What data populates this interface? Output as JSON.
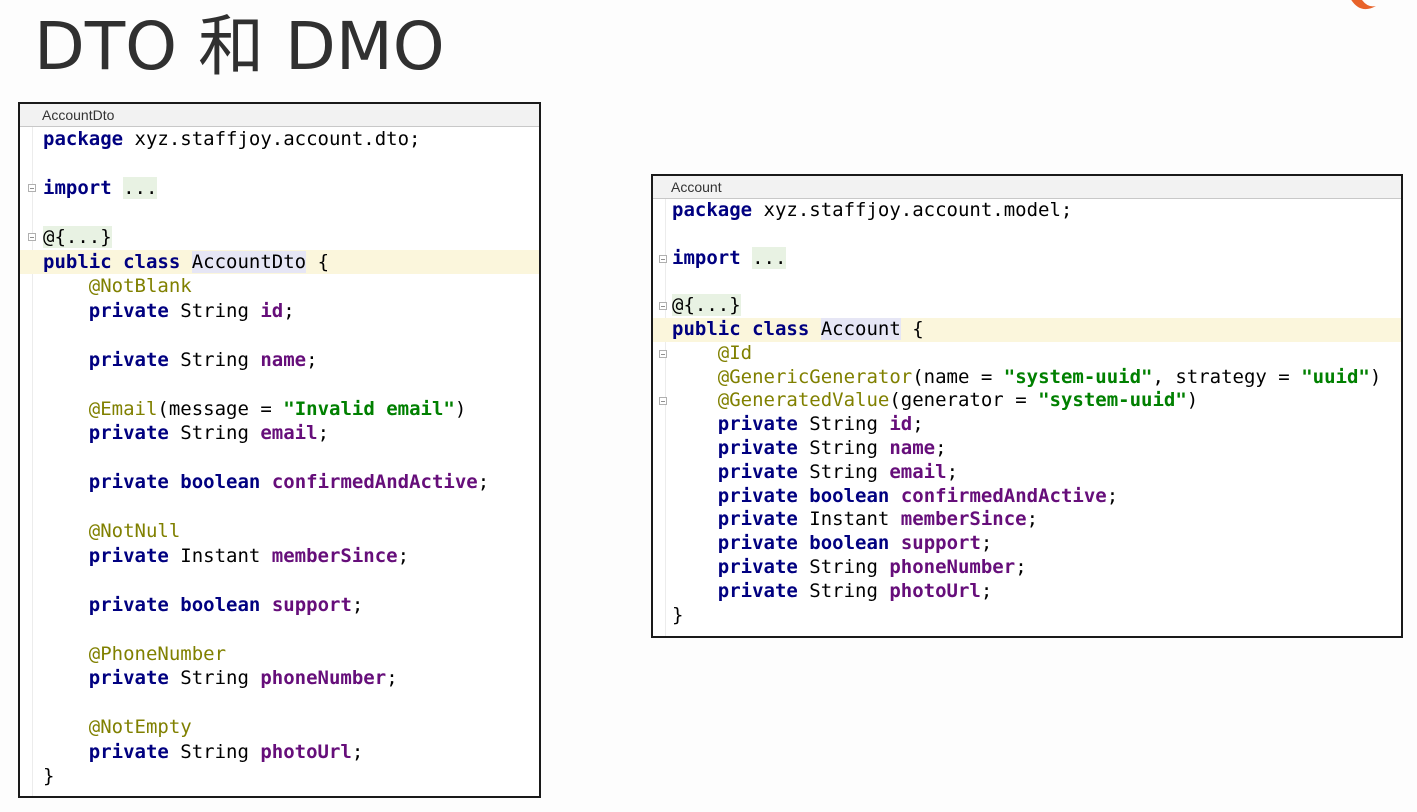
{
  "slide": {
    "title": "DTO 和 DMO"
  },
  "left_panel": {
    "tab_label": "AccountDto",
    "lines": [
      {
        "segments": [
          {
            "t": "package",
            "c": "kw"
          },
          {
            "t": " xyz.staffjoy.account.dto;",
            "c": ""
          }
        ]
      },
      {
        "segments": []
      },
      {
        "fold": true,
        "segments": [
          {
            "t": "import",
            "c": "kw"
          },
          {
            "t": " ",
            "c": ""
          },
          {
            "t": "...",
            "c": "fold"
          }
        ]
      },
      {
        "segments": []
      },
      {
        "fold": true,
        "segments": [
          {
            "t": "@{...}",
            "c": "fold"
          }
        ]
      },
      {
        "highlight": true,
        "segments": [
          {
            "t": "public class",
            "c": "kw"
          },
          {
            "t": " ",
            "c": ""
          },
          {
            "t": "AccountDto",
            "c": "sel"
          },
          {
            "t": " {",
            "c": ""
          }
        ]
      },
      {
        "segments": [
          {
            "t": "    ",
            "c": ""
          },
          {
            "t": "@NotBlank",
            "c": "ann"
          }
        ]
      },
      {
        "segments": [
          {
            "t": "    ",
            "c": ""
          },
          {
            "t": "private",
            "c": "kw"
          },
          {
            "t": " String ",
            "c": ""
          },
          {
            "t": "id",
            "c": "field"
          },
          {
            "t": ";",
            "c": ""
          }
        ]
      },
      {
        "segments": []
      },
      {
        "segments": [
          {
            "t": "    ",
            "c": ""
          },
          {
            "t": "private",
            "c": "kw"
          },
          {
            "t": " String ",
            "c": ""
          },
          {
            "t": "name",
            "c": "field"
          },
          {
            "t": ";",
            "c": ""
          }
        ]
      },
      {
        "segments": []
      },
      {
        "segments": [
          {
            "t": "    ",
            "c": ""
          },
          {
            "t": "@Email",
            "c": "ann"
          },
          {
            "t": "(message = ",
            "c": ""
          },
          {
            "t": "\"Invalid email\"",
            "c": "str"
          },
          {
            "t": ")",
            "c": ""
          }
        ]
      },
      {
        "segments": [
          {
            "t": "    ",
            "c": ""
          },
          {
            "t": "private",
            "c": "kw"
          },
          {
            "t": " String ",
            "c": ""
          },
          {
            "t": "email",
            "c": "field"
          },
          {
            "t": ";",
            "c": ""
          }
        ]
      },
      {
        "segments": []
      },
      {
        "segments": [
          {
            "t": "    ",
            "c": ""
          },
          {
            "t": "private boolean",
            "c": "kw"
          },
          {
            "t": " ",
            "c": ""
          },
          {
            "t": "confirmedAndActive",
            "c": "field"
          },
          {
            "t": ";",
            "c": ""
          }
        ]
      },
      {
        "segments": []
      },
      {
        "segments": [
          {
            "t": "    ",
            "c": ""
          },
          {
            "t": "@NotNull",
            "c": "ann"
          }
        ]
      },
      {
        "segments": [
          {
            "t": "    ",
            "c": ""
          },
          {
            "t": "private",
            "c": "kw"
          },
          {
            "t": " Instant ",
            "c": ""
          },
          {
            "t": "memberSince",
            "c": "field"
          },
          {
            "t": ";",
            "c": ""
          }
        ]
      },
      {
        "segments": []
      },
      {
        "segments": [
          {
            "t": "    ",
            "c": ""
          },
          {
            "t": "private boolean",
            "c": "kw"
          },
          {
            "t": " ",
            "c": ""
          },
          {
            "t": "support",
            "c": "field"
          },
          {
            "t": ";",
            "c": ""
          }
        ]
      },
      {
        "segments": []
      },
      {
        "segments": [
          {
            "t": "    ",
            "c": ""
          },
          {
            "t": "@PhoneNumber",
            "c": "ann"
          }
        ]
      },
      {
        "segments": [
          {
            "t": "    ",
            "c": ""
          },
          {
            "t": "private",
            "c": "kw"
          },
          {
            "t": " String ",
            "c": ""
          },
          {
            "t": "phoneNumber",
            "c": "field"
          },
          {
            "t": ";",
            "c": ""
          }
        ]
      },
      {
        "segments": []
      },
      {
        "segments": [
          {
            "t": "    ",
            "c": ""
          },
          {
            "t": "@NotEmpty",
            "c": "ann"
          }
        ]
      },
      {
        "segments": [
          {
            "t": "    ",
            "c": ""
          },
          {
            "t": "private",
            "c": "kw"
          },
          {
            "t": " String ",
            "c": ""
          },
          {
            "t": "photoUrl",
            "c": "field"
          },
          {
            "t": ";",
            "c": ""
          }
        ]
      },
      {
        "segments": [
          {
            "t": "}",
            "c": ""
          }
        ]
      }
    ]
  },
  "right_panel": {
    "tab_label": "Account",
    "lines": [
      {
        "segments": [
          {
            "t": "package",
            "c": "kw"
          },
          {
            "t": " xyz.staffjoy.account.model;",
            "c": ""
          }
        ]
      },
      {
        "segments": []
      },
      {
        "fold": true,
        "segments": [
          {
            "t": "import",
            "c": "kw"
          },
          {
            "t": " ",
            "c": ""
          },
          {
            "t": "...",
            "c": "fold"
          }
        ]
      },
      {
        "segments": []
      },
      {
        "fold": true,
        "segments": [
          {
            "t": "@{...}",
            "c": "fold"
          }
        ]
      },
      {
        "highlight": true,
        "segments": [
          {
            "t": "public class",
            "c": "kw"
          },
          {
            "t": " ",
            "c": ""
          },
          {
            "t": "Account",
            "c": "sel"
          },
          {
            "t": " {",
            "c": ""
          }
        ]
      },
      {
        "fold": true,
        "segments": [
          {
            "t": "    ",
            "c": ""
          },
          {
            "t": "@Id",
            "c": "ann"
          }
        ]
      },
      {
        "segments": [
          {
            "t": "    ",
            "c": ""
          },
          {
            "t": "@GenericGenerator",
            "c": "ann"
          },
          {
            "t": "(name = ",
            "c": ""
          },
          {
            "t": "\"system-uuid\"",
            "c": "str"
          },
          {
            "t": ", strategy = ",
            "c": ""
          },
          {
            "t": "\"uuid\"",
            "c": "str"
          },
          {
            "t": ")",
            "c": ""
          }
        ]
      },
      {
        "fold": true,
        "segments": [
          {
            "t": "    ",
            "c": ""
          },
          {
            "t": "@GeneratedValue",
            "c": "ann"
          },
          {
            "t": "(generator = ",
            "c": ""
          },
          {
            "t": "\"system-uuid\"",
            "c": "str"
          },
          {
            "t": ")",
            "c": ""
          }
        ]
      },
      {
        "segments": [
          {
            "t": "    ",
            "c": ""
          },
          {
            "t": "private",
            "c": "kw"
          },
          {
            "t": " String ",
            "c": ""
          },
          {
            "t": "id",
            "c": "field"
          },
          {
            "t": ";",
            "c": ""
          }
        ]
      },
      {
        "segments": [
          {
            "t": "    ",
            "c": ""
          },
          {
            "t": "private",
            "c": "kw"
          },
          {
            "t": " String ",
            "c": ""
          },
          {
            "t": "name",
            "c": "field"
          },
          {
            "t": ";",
            "c": ""
          }
        ]
      },
      {
        "segments": [
          {
            "t": "    ",
            "c": ""
          },
          {
            "t": "private",
            "c": "kw"
          },
          {
            "t": " String ",
            "c": ""
          },
          {
            "t": "email",
            "c": "field"
          },
          {
            "t": ";",
            "c": ""
          }
        ]
      },
      {
        "segments": [
          {
            "t": "    ",
            "c": ""
          },
          {
            "t": "private boolean",
            "c": "kw"
          },
          {
            "t": " ",
            "c": ""
          },
          {
            "t": "confirmedAndActive",
            "c": "field"
          },
          {
            "t": ";",
            "c": ""
          }
        ]
      },
      {
        "segments": [
          {
            "t": "    ",
            "c": ""
          },
          {
            "t": "private",
            "c": "kw"
          },
          {
            "t": " Instant ",
            "c": ""
          },
          {
            "t": "memberSince",
            "c": "field"
          },
          {
            "t": ";",
            "c": ""
          }
        ]
      },
      {
        "segments": [
          {
            "t": "    ",
            "c": ""
          },
          {
            "t": "private boolean",
            "c": "kw"
          },
          {
            "t": " ",
            "c": ""
          },
          {
            "t": "support",
            "c": "field"
          },
          {
            "t": ";",
            "c": ""
          }
        ]
      },
      {
        "segments": [
          {
            "t": "    ",
            "c": ""
          },
          {
            "t": "private",
            "c": "kw"
          },
          {
            "t": " String ",
            "c": ""
          },
          {
            "t": "phoneNumber",
            "c": "field"
          },
          {
            "t": ";",
            "c": ""
          }
        ]
      },
      {
        "segments": [
          {
            "t": "    ",
            "c": ""
          },
          {
            "t": "private",
            "c": "kw"
          },
          {
            "t": " String ",
            "c": ""
          },
          {
            "t": "photoUrl",
            "c": "field"
          },
          {
            "t": ";",
            "c": ""
          }
        ]
      },
      {
        "segments": [
          {
            "t": "}",
            "c": ""
          }
        ]
      }
    ]
  },
  "colors": {
    "keyword": "#000080",
    "annotation": "#808000",
    "field": "#660e7a",
    "string": "#008000",
    "line_highlight": "#fbf6dc",
    "logo": "#e8632a"
  },
  "icons": {
    "logo": "brand-logo-icon",
    "fold": "fold-marker-icon"
  }
}
